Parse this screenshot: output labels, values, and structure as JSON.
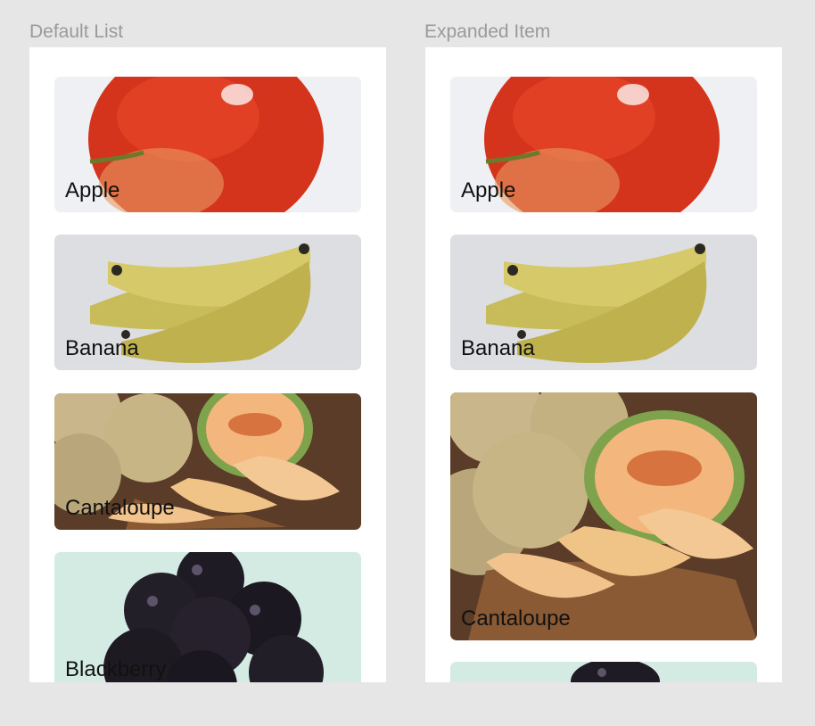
{
  "panels": {
    "default": {
      "title": "Default List"
    },
    "expanded": {
      "title": "Expanded Item"
    }
  },
  "fruits": [
    {
      "label": "Apple",
      "image_icon": "apple-photo"
    },
    {
      "label": "Banana",
      "image_icon": "banana-photo"
    },
    {
      "label": "Cantaloupe",
      "image_icon": "cantaloupe-photo"
    },
    {
      "label": "Blackberry",
      "image_icon": "blackberry-photo"
    }
  ],
  "colors": {
    "background": "#e6e6e6",
    "panel": "#ffffff",
    "title": "#9a9a9a",
    "label": "#111111"
  }
}
